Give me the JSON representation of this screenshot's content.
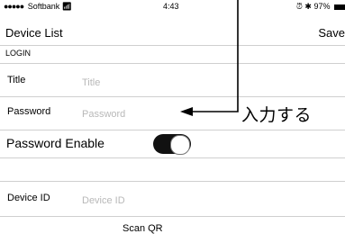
{
  "status_bar": {
    "signal_dots": "●●●●●",
    "carrier": "Softbank",
    "wifi_icon": "wifi-icon",
    "time": "4:43",
    "alarm_icon": "alarm-icon",
    "bluetooth_icon": "bluetooth-icon",
    "battery_percent": "97%"
  },
  "nav": {
    "title": "Device List",
    "save_label": "Save"
  },
  "section": {
    "header": "LOGIN"
  },
  "form": {
    "title_label": "Title",
    "title_placeholder": "Title",
    "password_label": "Password",
    "password_placeholder": "Password",
    "password_enable_label": "Password Enable",
    "password_enable_on": true,
    "device_id_label": "Device ID",
    "device_id_placeholder": "Device ID",
    "scan_qr_label": "Scan QR"
  },
  "annotation": {
    "text": "入力する"
  }
}
